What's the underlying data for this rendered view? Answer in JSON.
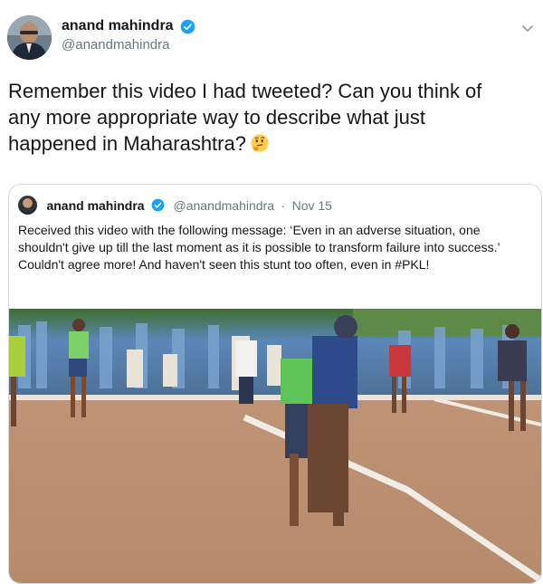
{
  "author": {
    "display_name": "anand mahindra",
    "handle": "@anandmahindra",
    "verified_icon": "verified-badge-icon"
  },
  "tweet": {
    "text": "Remember this video I had tweeted? Can you think of any more appropriate way to describe what just happened in Maharashtra?",
    "emoji": "thinking-face-icon"
  },
  "quoted": {
    "display_name": "anand mahindra",
    "handle": "@anandmahindra",
    "separator": "·",
    "date": "Nov 15",
    "text": "Received this video with the following message: ‘Even in an adverse situation, one shouldn't give up till the last moment as it is possible to transform failure into success.’ Couldn't agree more! And haven't seen this stunt too often, even in #PKL!",
    "media": "kabaddi-match-video"
  },
  "colors": {
    "verified_blue": "#1da1f2",
    "text_primary": "#14171a",
    "text_secondary": "#657786",
    "border": "#cfd9de"
  }
}
